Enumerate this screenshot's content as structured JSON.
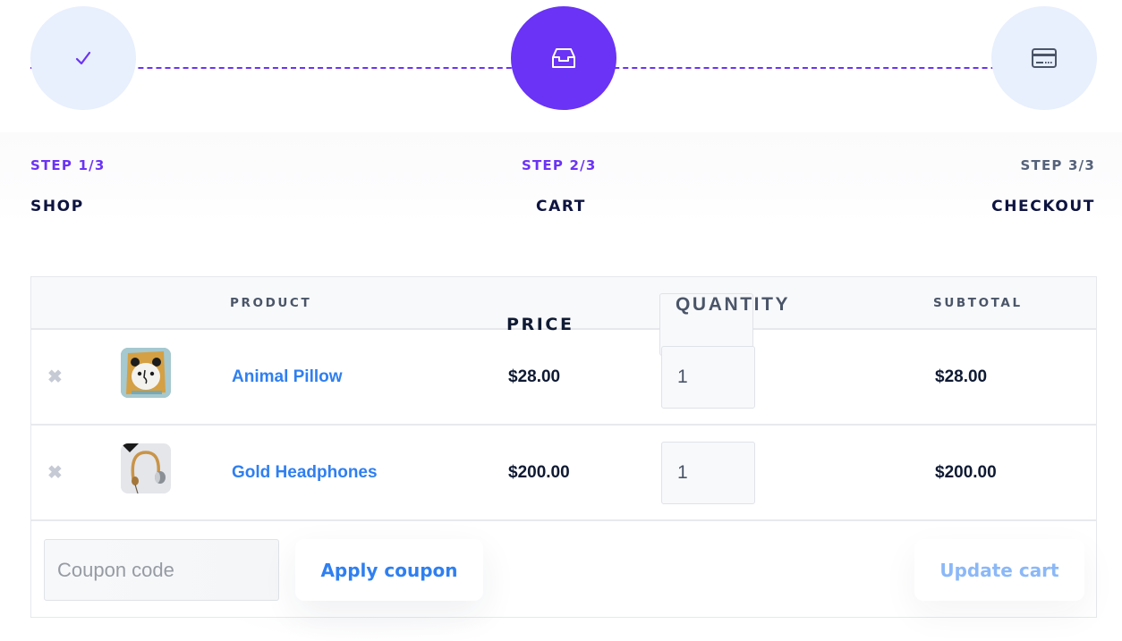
{
  "stepper": {
    "steps": [
      {
        "number": "STEP 1/3",
        "title": "SHOP",
        "icon": "check-icon",
        "state": "completed"
      },
      {
        "number": "STEP 2/3",
        "title": "CART",
        "icon": "inbox-tray-icon",
        "state": "active"
      },
      {
        "number": "STEP 3/3",
        "title": "CHECKOUT",
        "icon": "credit-card-icon",
        "state": "upcoming"
      }
    ]
  },
  "cart": {
    "columns": {
      "product": "PRODUCT",
      "price": "PRICE",
      "quantity": "QUANTITY",
      "subtotal": "SUBTOTAL"
    },
    "items": [
      {
        "name": "Animal Pillow",
        "price": "$28.00",
        "quantity": "1",
        "subtotal": "$28.00",
        "thumbnail": "pillow-thumbnail",
        "remove_icon": "close-icon"
      },
      {
        "name": "Gold Headphones",
        "price": "$200.00",
        "quantity": "1",
        "subtotal": "$200.00",
        "thumbnail": "headphones-thumbnail",
        "remove_icon": "close-icon"
      }
    ],
    "coupon": {
      "placeholder": "Coupon code",
      "value": ""
    },
    "apply_coupon_label": "Apply coupon",
    "update_cart_label": "Update cart"
  },
  "colors": {
    "accent": "#6a33f5",
    "link": "#2f7ff0",
    "step_inactive_bg": "#e8effd",
    "update_disabled": "#8bb8f7"
  }
}
